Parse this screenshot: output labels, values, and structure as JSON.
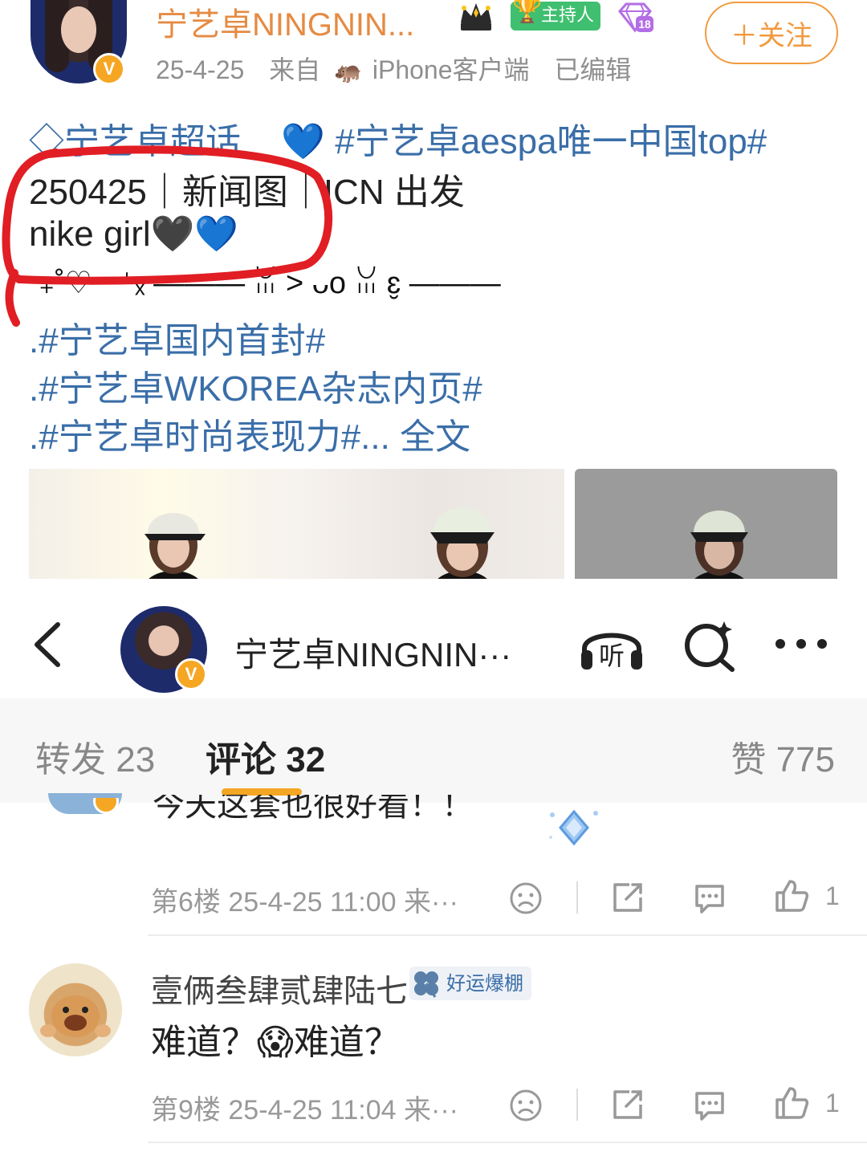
{
  "post": {
    "username": "宁艺卓NINGNIN...",
    "host_badge": "主持人",
    "diamond_level": "18",
    "verified_mark": "V",
    "date": "25-4-25",
    "source": "来自",
    "device": "iPhone客户端",
    "edited": "已编辑",
    "follow_label": "＋关注",
    "line1_topic": "宁艺卓超话",
    "line1_tag": "#宁艺卓aespa唯一中国top#",
    "line2": "250425｜新闻图｜ICN 出发",
    "line3": "nike girl",
    "line4": "‧₊˚♡ ‧ ⁺ₓ ——— ꈍ > ᴗo ꈍ ɛ̮ ———",
    "line5": ".#宁艺卓国内首封#",
    "line6": ".#宁艺卓WKOREA杂志内页#",
    "line7_tag": ".#宁艺卓时尚表现力#...",
    "line7_expand": "全文"
  },
  "nav": {
    "title": "宁艺卓NINGNIN···",
    "listen_label": "听"
  },
  "tabs": {
    "repost": "转发 23",
    "comments": "评论 32",
    "likes": "赞 775"
  },
  "comments": [
    {
      "text": "今天这套也很好看！！",
      "floor": "第6楼",
      "time": "25-4-25 11:00",
      "source": "来···",
      "likes": "1"
    },
    {
      "name": "壹俩叁肆贰肆陆七",
      "badge": "好运爆棚",
      "text_a": "难道？",
      "emoji": "😱",
      "text_b": "难道？",
      "floor": "第9楼",
      "time": "25-4-25 11:04",
      "source": "来···",
      "likes": "1"
    }
  ],
  "colors": {
    "username": "#e58b43",
    "topic": "#3a6ea8",
    "follow": "#f19a3e",
    "tab_underline": "#f5a623",
    "annotation_circle": "#e01e24"
  }
}
